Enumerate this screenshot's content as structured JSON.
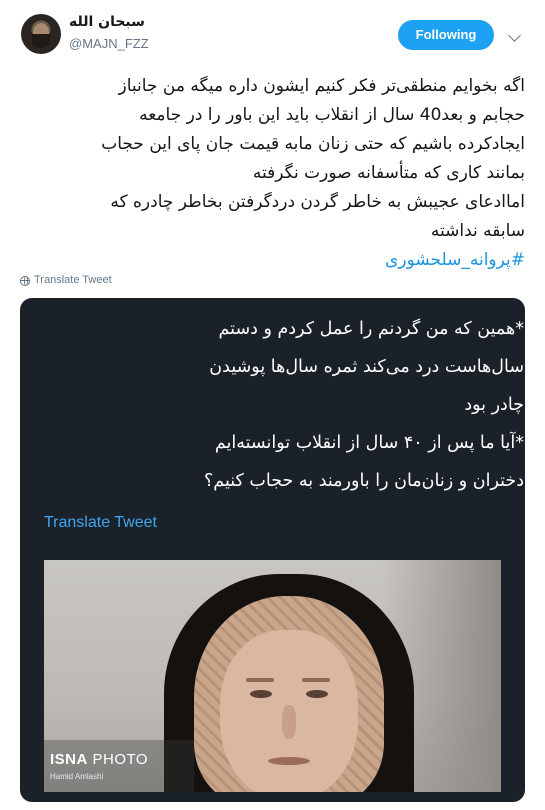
{
  "user": {
    "display_name": "سبحان الله",
    "handle": "@MAJN_FZZ"
  },
  "follow_button": {
    "label": "Following",
    "color": "#1da1f2"
  },
  "tweet": {
    "lines": [
      "اگه بخوایم منطقی‌تر فکر کنیم ایشون داره میگه من جانباز",
      "حجابم و بعد40 سال از انقلاب باید این باور را در جامعه",
      "ایجادکرده باشیم که حتی زنان مابه قیمت جان پای این حجاب",
      "بمانند کاری که متأسفانه صورت نگرفته",
      "اماادعای عجیبش به خاطر گردن دردگرفتن بخاطر چادره که",
      "سابقه نداشته"
    ],
    "hashtag": "#پروانه_سلحشوری",
    "translate_label": "Translate Tweet"
  },
  "quoted_card": {
    "lines": [
      "*همین که من گردنم را عمل کردم و دستم",
      "سال‌هاست درد می‌کند ثمره سال‌ها پوشیدن",
      "چادر بود",
      "*آیا ما پس از ۴۰ سال از انقلاب توانسته‌ایم",
      "دختران و زنان‌مان را باورمند به حجاب کنیم؟"
    ],
    "translate_label": "Translate Tweet",
    "background": "#1b2128",
    "link_color": "#3ea6f2"
  },
  "photo": {
    "watermark_brand": "ISNA",
    "watermark_word": "PHOTO",
    "watermark_credit": "Hamid Amlashi"
  },
  "icons": {
    "globe": "globe-icon",
    "chevron": "chevron-down-icon"
  }
}
